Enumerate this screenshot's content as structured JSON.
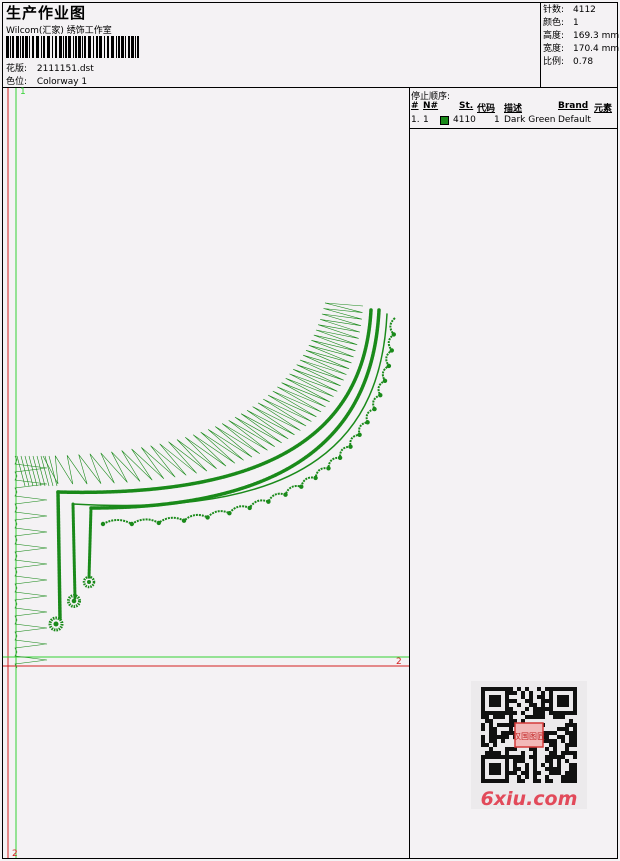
{
  "header": {
    "title": "生产作业图",
    "company": "Wilcom(汇家) 绣饰工作室",
    "design_label": "花版:",
    "design_value": "2111151.dst",
    "colorway_label": "色位:",
    "colorway_value": "Colorway 1"
  },
  "stats": [
    {
      "label": "针数:",
      "value": "4112"
    },
    {
      "label": "颜色:",
      "value": "1"
    },
    {
      "label": "高度:",
      "value": "169.3 mm"
    },
    {
      "label": "宽度:",
      "value": "170.4 mm"
    },
    {
      "label": "比例:",
      "value": "0.78"
    }
  ],
  "stop_sequence": {
    "title": "停止顺序:",
    "columns": [
      "#",
      "N#",
      "St.",
      "代码",
      "描述",
      "Brand",
      "元素"
    ],
    "rows": [
      {
        "index": "1.",
        "needle": "1",
        "code": "4110",
        "stitches": "1",
        "description": "Dark Green",
        "brand": "Default",
        "color": "#1a8a1a"
      }
    ]
  },
  "axis_labels": {
    "green_top": "1",
    "green_right": "2",
    "red_bottom": "2"
  },
  "colors": {
    "thread": "#1a8a1a",
    "guide_green": "#34d234",
    "guide_red": "#d42020"
  },
  "watermark": {
    "text": "6xiu.com",
    "stamp": "汉国图匠"
  }
}
